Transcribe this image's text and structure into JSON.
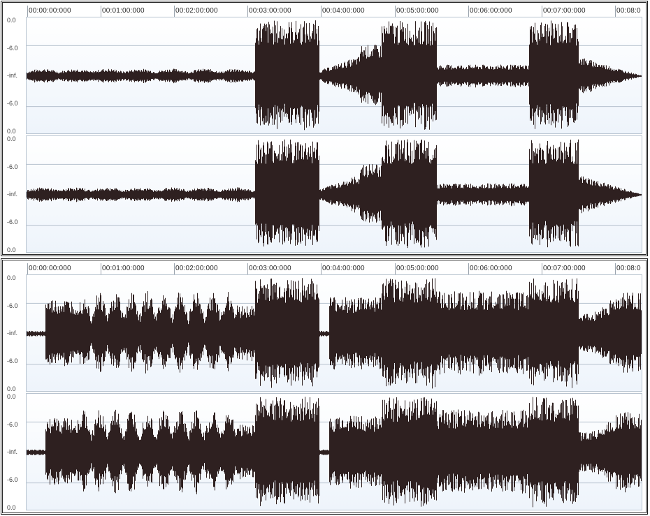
{
  "app": {
    "panels": [
      {
        "name": "waveform-panel-1",
        "timeline": [
          "00:00:00:000",
          "00:01:00:000",
          "00:02:00:000",
          "00:03:00:000",
          "00:04:00:000",
          "00:05:00:000",
          "00:06:00:000",
          "00:07:00:000",
          "00:08:0"
        ],
        "channels": [
          {
            "name": "left",
            "db_labels": [
              "0.0",
              "-6.0",
              "-inf.",
              "-6.0",
              "0.0"
            ]
          },
          {
            "name": "right",
            "db_labels": [
              "0.0",
              "-6.0",
              "-inf.",
              "-6.0",
              "0.0"
            ]
          }
        ]
      },
      {
        "name": "waveform-panel-2",
        "timeline": [
          "00:00:00:000",
          "00:01:00:000",
          "00:02:00:000",
          "00:03:00:000",
          "00:04:00:000",
          "00:05:00:000",
          "00:06:00:000",
          "00:07:00:000",
          "00:08:0"
        ],
        "channels": [
          {
            "name": "left",
            "db_labels": [
              "0.0",
              "-6.0",
              "-inf.",
              "-6.0",
              "0.0"
            ]
          },
          {
            "name": "right",
            "db_labels": [
              "0.0",
              "-6.0",
              "-inf.",
              "-6.0",
              "0.0"
            ]
          }
        ]
      }
    ],
    "colors": {
      "waveform": "#2e2020",
      "grid": "#b6c2ce",
      "background": "#f0f5fb"
    }
  }
}
